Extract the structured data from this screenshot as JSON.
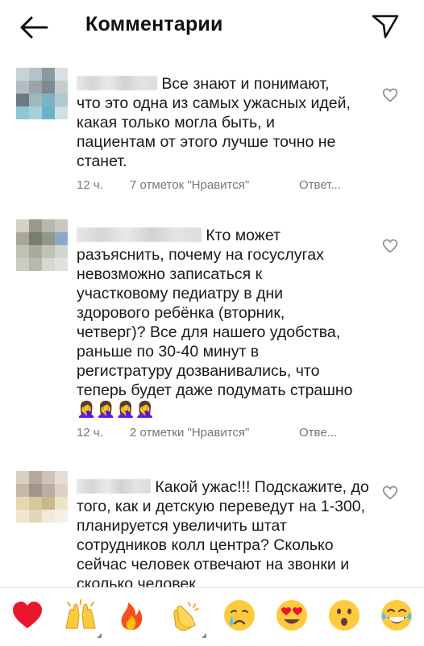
{
  "header": {
    "title": "Комментарии"
  },
  "comments": [
    {
      "text": "Все знают и понимают, что это одна из самых ужасных идей, какая только могла быть, и пациентам от этого лучше точно не станет.",
      "time": "12 ч.",
      "likes": "7 отметок \"Нравится\"",
      "reply": "Ответ..."
    },
    {
      "text": "Кто может разъяснить, почему на госуслугах невозможно записаться к участковому педиатру в дни здорового ребёнка (вторник, четверг)? Все для нашего удобства, раньше по 30-40 минут в регистратуру дозванивались, что теперь будет даже подумать страшно 🤦‍♀️🤦‍♀️🤦‍♀️🤦‍♀️",
      "time": "12 ч.",
      "likes": "2 отметки \"Нравится\"",
      "reply": "Отве..."
    },
    {
      "text": "Какой ужас!!! Подскажите, до того, как и детскую переведут на 1-300, планируется увеличить штат сотрудников колл центра? Сколько сейчас человек отвечают на звонки и сколько человек",
      "time": "",
      "likes": "",
      "reply": ""
    }
  ],
  "emoji_bar": [
    "red-heart",
    "raised-hands",
    "fire",
    "clapping-hands",
    "crying-face",
    "heart-eyes",
    "astonished-face",
    "tears-of-joy"
  ],
  "colors": {
    "heart": "#e8172c",
    "emoji_yellow": "#ffcb3d",
    "meta_gray": "#777777"
  }
}
